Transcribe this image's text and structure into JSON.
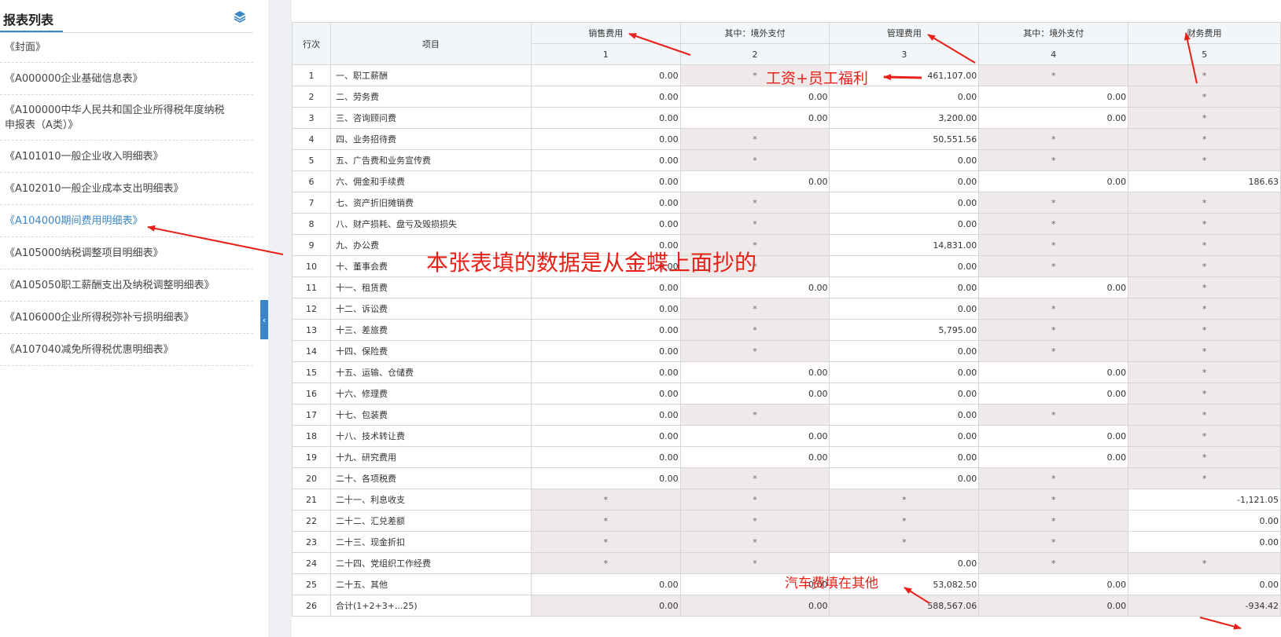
{
  "sidebar": {
    "title": "报表列表",
    "items": [
      {
        "label": "《封面》",
        "active": false
      },
      {
        "label": "《A000000企业基础信息表》",
        "active": false
      },
      {
        "label": "《A100000中华人民共和国企业所得税年度纳税申报表（A类）》",
        "active": false
      },
      {
        "label": "《A101010一般企业收入明细表》",
        "active": false
      },
      {
        "label": "《A102010一般企业成本支出明细表》",
        "active": false
      },
      {
        "label": "《A104000期间费用明细表》",
        "active": true
      },
      {
        "label": "《A105000纳税调整项目明细表》",
        "active": false
      },
      {
        "label": "《A105050职工薪酬支出及纳税调整明细表》",
        "active": false
      },
      {
        "label": "《A106000企业所得税弥补亏损明细表》",
        "active": false
      },
      {
        "label": "《A107040减免所得税优惠明细表》",
        "active": false
      }
    ]
  },
  "table": {
    "col_row": "行次",
    "col_item": "项目",
    "headers": [
      "销售费用",
      "其中：境外支付",
      "管理费用",
      "其中：境外支付",
      "财务费用"
    ],
    "col_numbers": [
      "1",
      "2",
      "3",
      "4",
      "5"
    ],
    "rows": [
      {
        "n": "1",
        "item": "一、职工薪酬",
        "c": [
          "0.00",
          "*",
          "461,107.00",
          "*",
          "*"
        ]
      },
      {
        "n": "2",
        "item": "二、劳务费",
        "c": [
          "0.00",
          "0.00",
          "0.00",
          "0.00",
          "*"
        ]
      },
      {
        "n": "3",
        "item": "三、咨询顾问费",
        "c": [
          "0.00",
          "0.00",
          "3,200.00",
          "0.00",
          "*"
        ]
      },
      {
        "n": "4",
        "item": "四、业务招待费",
        "c": [
          "0.00",
          "*",
          "50,551.56",
          "*",
          "*"
        ]
      },
      {
        "n": "5",
        "item": "五、广告费和业务宣传费",
        "c": [
          "0.00",
          "*",
          "0.00",
          "*",
          "*"
        ]
      },
      {
        "n": "6",
        "item": "六、佣金和手续费",
        "c": [
          "0.00",
          "0.00",
          "0.00",
          "0.00",
          "186.63"
        ]
      },
      {
        "n": "7",
        "item": "七、资产折旧摊销费",
        "c": [
          "0.00",
          "*",
          "0.00",
          "*",
          "*"
        ]
      },
      {
        "n": "8",
        "item": "八、财产损耗、盘亏及毁损损失",
        "c": [
          "0.00",
          "*",
          "0.00",
          "*",
          "*"
        ]
      },
      {
        "n": "9",
        "item": "九、办公费",
        "c": [
          "0.00",
          "*",
          "14,831.00",
          "*",
          "*"
        ]
      },
      {
        "n": "10",
        "item": "十、董事会费",
        "c": [
          "0.00",
          "*",
          "0.00",
          "*",
          "*"
        ]
      },
      {
        "n": "11",
        "item": "十一、租赁费",
        "c": [
          "0.00",
          "0.00",
          "0.00",
          "0.00",
          "*"
        ]
      },
      {
        "n": "12",
        "item": "十二、诉讼费",
        "c": [
          "0.00",
          "*",
          "0.00",
          "*",
          "*"
        ]
      },
      {
        "n": "13",
        "item": "十三、差旅费",
        "c": [
          "0.00",
          "*",
          "5,795.00",
          "*",
          "*"
        ]
      },
      {
        "n": "14",
        "item": "十四、保险费",
        "c": [
          "0.00",
          "*",
          "0.00",
          "*",
          "*"
        ]
      },
      {
        "n": "15",
        "item": "十五、运输、仓储费",
        "c": [
          "0.00",
          "0.00",
          "0.00",
          "0.00",
          "*"
        ]
      },
      {
        "n": "16",
        "item": "十六、修理费",
        "c": [
          "0.00",
          "0.00",
          "0.00",
          "0.00",
          "*"
        ]
      },
      {
        "n": "17",
        "item": "十七、包装费",
        "c": [
          "0.00",
          "*",
          "0.00",
          "*",
          "*"
        ]
      },
      {
        "n": "18",
        "item": "十八、技术转让费",
        "c": [
          "0.00",
          "0.00",
          "0.00",
          "0.00",
          "*"
        ]
      },
      {
        "n": "19",
        "item": "十九、研究费用",
        "c": [
          "0.00",
          "0.00",
          "0.00",
          "0.00",
          "*"
        ]
      },
      {
        "n": "20",
        "item": "二十、各项税费",
        "c": [
          "0.00",
          "*",
          "0.00",
          "*",
          "*"
        ]
      },
      {
        "n": "21",
        "item": "二十一、利息收支",
        "c": [
          "*",
          "*",
          "*",
          "*",
          "-1,121.05"
        ]
      },
      {
        "n": "22",
        "item": "二十二、汇兑差额",
        "c": [
          "*",
          "*",
          "*",
          "*",
          "0.00"
        ]
      },
      {
        "n": "23",
        "item": "二十三、现金折扣",
        "c": [
          "*",
          "*",
          "*",
          "*",
          "0.00"
        ]
      },
      {
        "n": "24",
        "item": "二十四、党组织工作经费",
        "c": [
          "*",
          "*",
          "0.00",
          "*",
          "*"
        ]
      },
      {
        "n": "25",
        "item": "二十五、其他",
        "c": [
          "0.00",
          "0.00",
          "53,082.50",
          "0.00",
          "0.00"
        ]
      },
      {
        "n": "26",
        "item": "合计(1+2+3+...25)",
        "c": [
          "0.00",
          "0.00",
          "588,567.06",
          "0.00",
          "-934.42"
        ]
      }
    ]
  },
  "annotations": {
    "salary_note": "工资+员工福利",
    "source_note": "本张表填的数据是从金蝶上面抄的",
    "car_note": "汽车费填在其他"
  },
  "colors": {
    "accent": "#3a86c8",
    "annotation": "#e82018",
    "disabled_cell": "#efe9ea",
    "header_bg": "#f3f6f9"
  }
}
